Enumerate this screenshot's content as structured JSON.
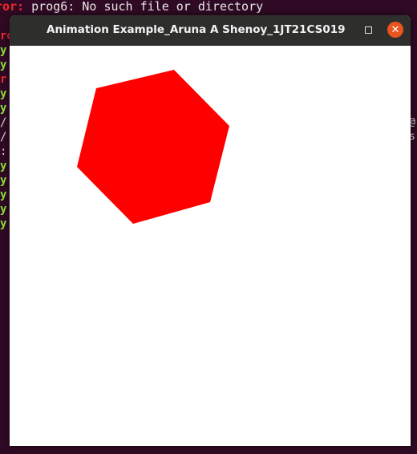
{
  "terminal": {
    "error_prefix": "ror:",
    "error_message": " prog6: No such file or directory"
  },
  "window": {
    "title": "Animation Example_Aruna A Shenoy_1JT21CS019",
    "minimize_label": "–",
    "close_label": "✕"
  },
  "canvas": {
    "shape": "hexagon",
    "fill_color": "#ff0000",
    "background_color": "#ffffff"
  },
  "colors": {
    "terminal_bg": "#300a24",
    "titlebar_bg": "#2e2e2c",
    "close_button": "#e9541f"
  }
}
